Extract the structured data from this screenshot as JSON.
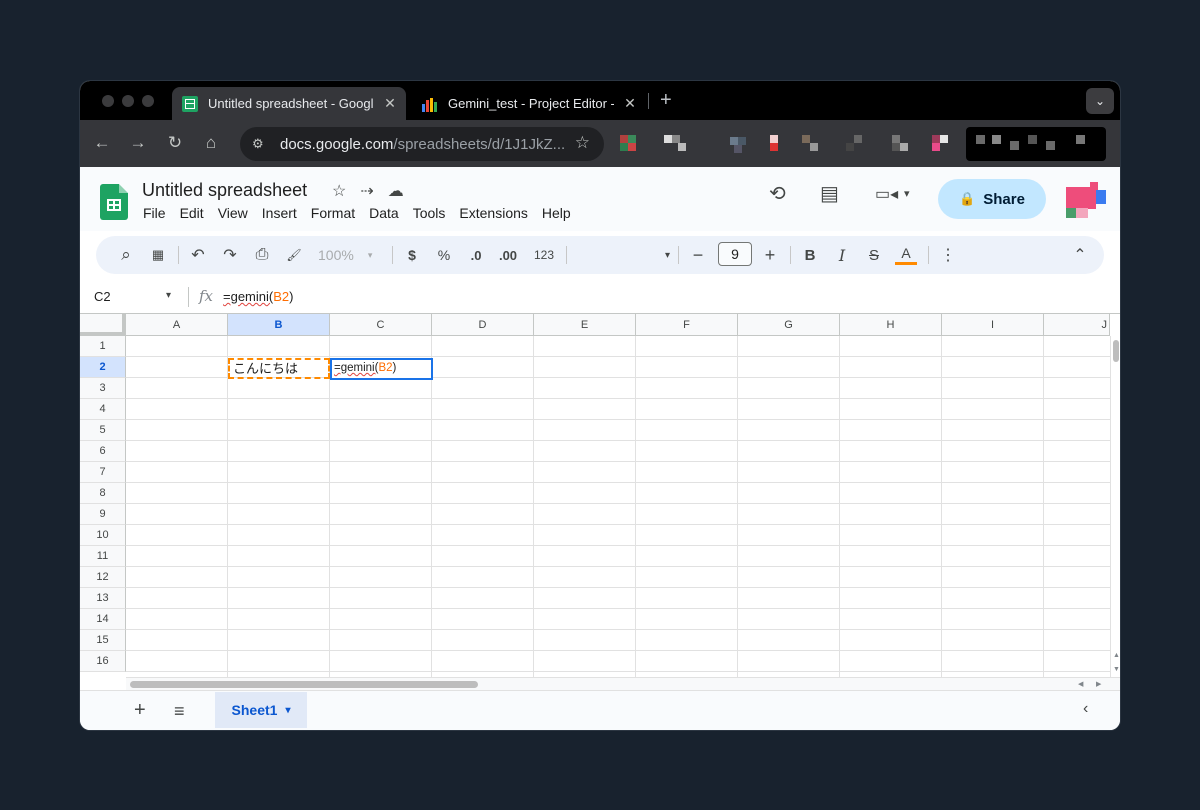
{
  "browser": {
    "tabs": [
      {
        "title": "Untitled spreadsheet - Google",
        "active": true,
        "close": "✕"
      },
      {
        "title": "Gemini_test - Project Editor -",
        "active": false,
        "close": "✕"
      }
    ],
    "new_tab": "+",
    "tab_menu_icon": "chevron-down-icon",
    "tab_menu_glyph": "⌄",
    "back": "←",
    "forward": "→",
    "reload": "↻",
    "home": "⌂",
    "url_host": "docs.google.com",
    "url_path": "/spreadsheets/d/1J1JkZ...",
    "bookmark_star": "☆"
  },
  "doc": {
    "title": "Untitled spreadsheet",
    "star": "☆",
    "move": "⇢",
    "cloud": "☁",
    "menus": [
      "File",
      "Edit",
      "View",
      "Insert",
      "Format",
      "Data",
      "Tools",
      "Extensions",
      "Help"
    ],
    "history_icon": "⟲",
    "comment_icon": "▤",
    "meet_icon": "▭◂",
    "meet_arrow": "▾",
    "share_label": "Share",
    "lock": "🔒"
  },
  "toolbar": {
    "search": "⌕",
    "menus": "▦",
    "undo": "↶",
    "redo": "↷",
    "print": "⎙",
    "paint": "🖌",
    "zoom": "100%",
    "zoom_arrow": "▾",
    "currency": "$",
    "percent": "%",
    "dec_decrease": ".0",
    "dec_increase": ".00",
    "number_format": "123",
    "font_arrow": "▾",
    "minus": "−",
    "font_size": "9",
    "plus": "+",
    "bold": "B",
    "italic": "I",
    "strike": "S",
    "text_color": "A",
    "more": "⋮",
    "collapse": "⌃"
  },
  "formula_bar": {
    "name_box": "C2",
    "name_arrow": "▾",
    "fx": "fx",
    "formula_prefix": "=gemini(",
    "formula_ref": "B2",
    "formula_suffix": ")"
  },
  "grid": {
    "columns": [
      "A",
      "B",
      "C",
      "D",
      "E",
      "F",
      "G",
      "H",
      "I",
      "J"
    ],
    "rows": [
      "1",
      "2",
      "3",
      "4",
      "5",
      "6",
      "7",
      "8",
      "9",
      "10",
      "11",
      "12",
      "13",
      "14",
      "15",
      "16"
    ],
    "selected_column": "B",
    "selected_row": "2",
    "cells": {
      "B2": "こんにちは",
      "C2_prefix": "=gemini(",
      "C2_ref": "B2",
      "C2_suffix": ")"
    }
  },
  "sheets": {
    "add": "+",
    "list": "≡",
    "active_sheet": "Sheet1",
    "sheet_arrow": "▾",
    "collapse": "‹"
  },
  "colors": {
    "sheets_green": "#1ea362",
    "selection_blue": "#1a73e8",
    "reference_orange": "#ff6d01",
    "share_button": "#c2e7ff"
  }
}
